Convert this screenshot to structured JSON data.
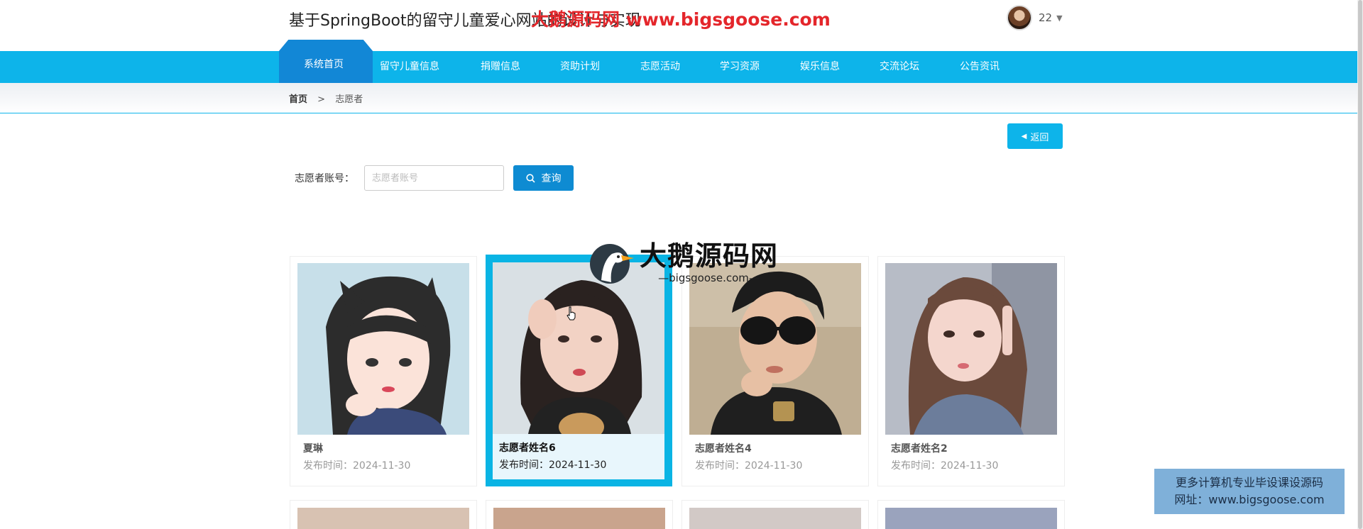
{
  "header": {
    "site_title": "基于SpringBoot的留守儿童爱心网站的设计与实现",
    "watermark": "大鹅源码网 www.bigsgoose.com",
    "user_name": "22"
  },
  "nav": {
    "items": [
      "系统首页",
      "留守儿童信息",
      "捐赠信息",
      "资助计划",
      "志愿活动",
      "学习资源",
      "娱乐信息",
      "交流论坛",
      "公告资讯"
    ],
    "active_index": 0
  },
  "breadcrumb": {
    "home": "首页",
    "separator": ">",
    "current": "志愿者"
  },
  "back_button": {
    "label": "返回"
  },
  "search": {
    "label": "志愿者账号：",
    "placeholder": "志愿者账号",
    "value": "",
    "button_label": "查询"
  },
  "cards": [
    {
      "name": "夏琳",
      "date_label": "发布时间：",
      "date": "2024-11-30",
      "active": false
    },
    {
      "name": "志愿者姓名6",
      "date_label": "发布时间：",
      "date": "2024-11-30",
      "active": true
    },
    {
      "name": "志愿者姓名4",
      "date_label": "发布时间：",
      "date": "2024-11-30",
      "active": false
    },
    {
      "name": "志愿者姓名2",
      "date_label": "发布时间：",
      "date": "2024-11-30",
      "active": false
    }
  ],
  "watermark_center": {
    "title": "大鹅源码网",
    "subtitle": "—bigsgoose.com—"
  },
  "corner_ad": {
    "line1": "更多计算机专业毕设课设源码",
    "line2": "网址：www.bigsgoose.com"
  },
  "colors": {
    "nav": "#0db4ea",
    "nav_active": "#1287d6",
    "button": "#0e8bd2",
    "watermark": "#e4262b"
  }
}
